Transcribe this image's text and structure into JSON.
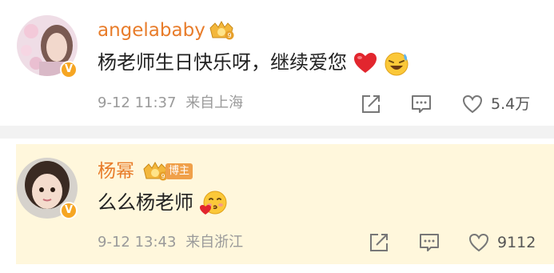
{
  "comments": [
    {
      "username": "angelababy",
      "text": "杨老师生日快乐呀，继续爱您",
      "timestamp": "9-12 11:37",
      "location": "来自上海",
      "likes": "5.4万",
      "emojis": [
        "heart-emoji",
        "laugh-tears-emoji"
      ],
      "verified": "V"
    },
    {
      "username": "杨幂",
      "badge": "博主",
      "text": "么么杨老师",
      "timestamp": "9-12 13:43",
      "location": "来自浙江",
      "likes": "9112",
      "emojis": [
        "kiss-emoji"
      ],
      "verified": "V"
    }
  ],
  "icons": {
    "repost": "repost-icon",
    "comment": "comment-icon",
    "like": "like-icon",
    "rank": "crown-rank-icon"
  },
  "colors": {
    "username": "#e87c2a",
    "highlight_bg": "#fff7dc",
    "meta_text": "#9a9a9a",
    "heart": "#e2262e",
    "verified_badge": "#f6a623"
  }
}
